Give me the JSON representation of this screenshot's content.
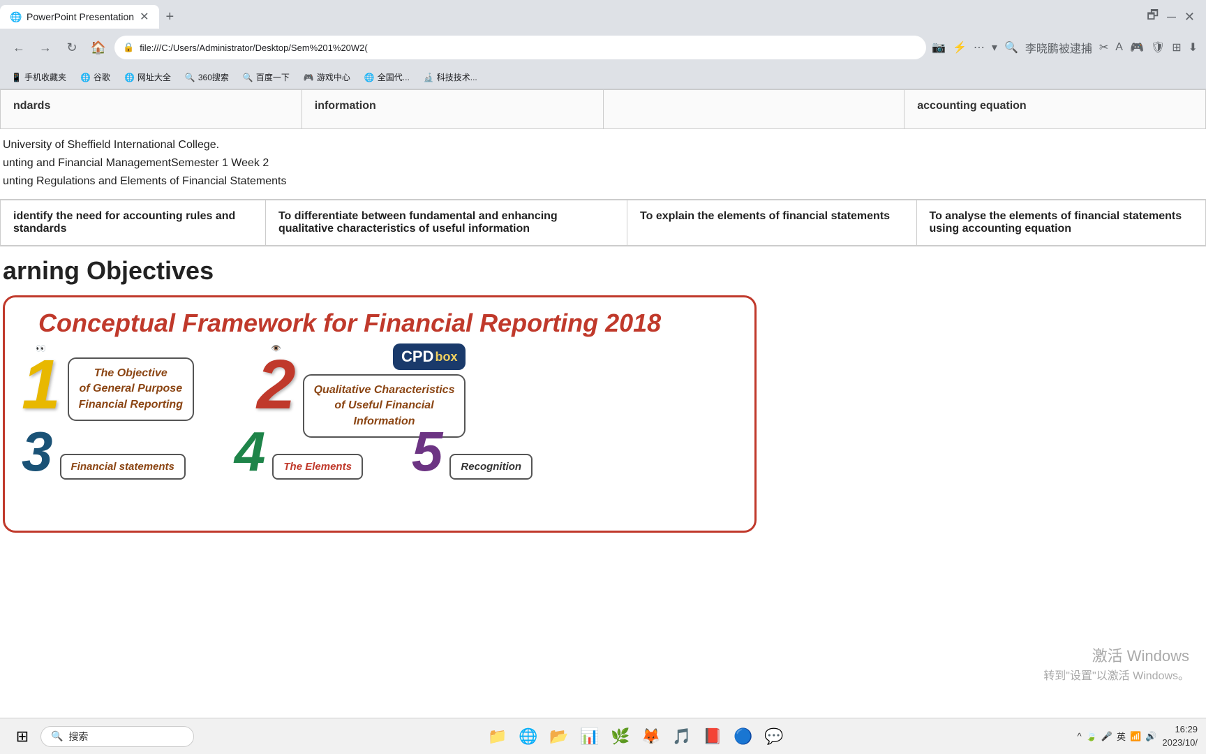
{
  "browser": {
    "tab_title": "PowerPoint Presentation",
    "tab_favicon": "🌐",
    "url": "file:///C:/Users/Administrator/Desktop/Sem%201%20W2(",
    "search_placeholder": "李晓鹏被逮捕",
    "bookmarks": [
      "手机收藏夹",
      "谷歌",
      "网址大全",
      "360搜索",
      "百度一下",
      "游戏中心",
      "全国代...",
      "科技技术..."
    ]
  },
  "page": {
    "table_header_col1": "ndards",
    "table_header_col2": "information",
    "table_header_col3": "",
    "table_header_col4": "accounting equation",
    "university": "University of Sheffield International College.",
    "course": "unting and Financial ManagementSemester 1 Week 2",
    "topic": "unting Regulations and Elements of Financial Statements",
    "obj1": "identify the need for accounting rules and standards",
    "obj2": "To differentiate between fundamental and enhancing qualitative characteristics of useful information",
    "obj3": "To explain the elements of financial statements",
    "obj4": "To analyse the elements of financial statements using accounting equation",
    "section_title": "arning Objectives",
    "cpd_title": "Conceptual Framework for Financial Reporting  2018",
    "box1_num": "1",
    "box1_label": "The Objective\nof General Purpose\nFinancial Reporting",
    "box2_num": "2",
    "box2_label": "Qualitative Characteristics\nof Useful Financial\nInformation",
    "cpd_logo": "CPD box",
    "char3_label": "Financial statements",
    "char4_label": "The Elements",
    "char5_label": "Recognition",
    "watermark_line1": "激活 Windows",
    "watermark_line2": "转到\"设置\"以激活 Windows。"
  },
  "taskbar": {
    "search_placeholder": "搜索",
    "time": "16:29",
    "date": "2023/10/",
    "input_method": "英"
  }
}
